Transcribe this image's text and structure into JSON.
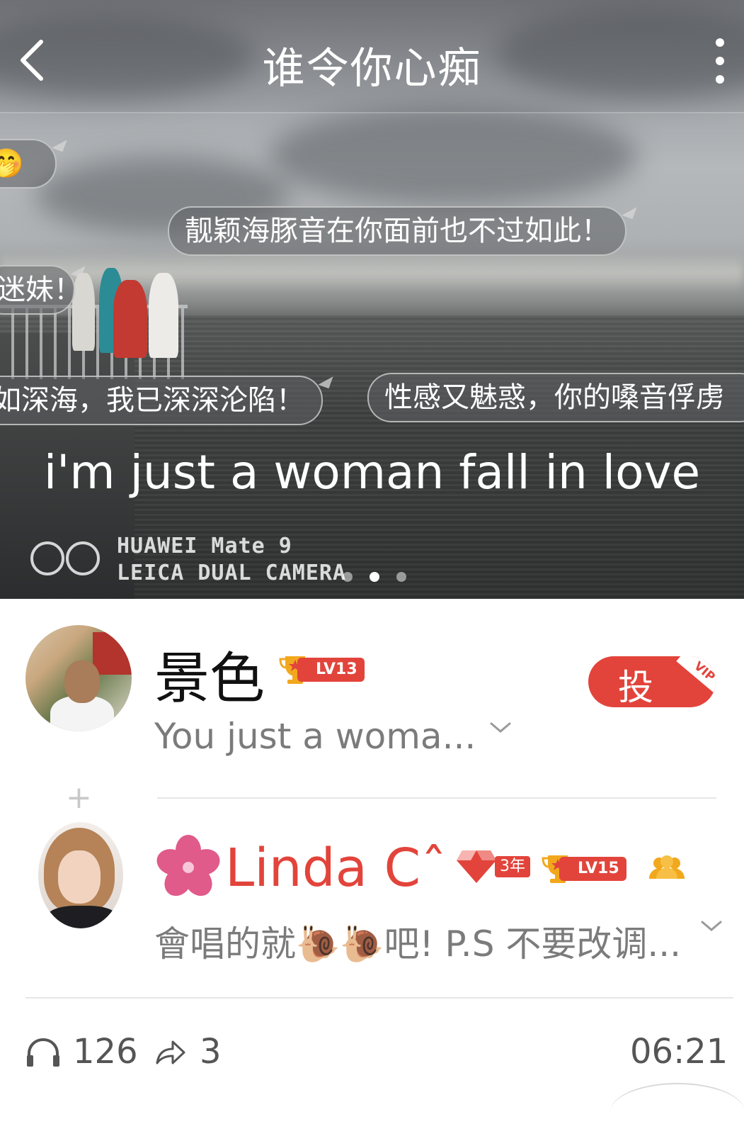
{
  "header": {
    "title": "谁令你心痴"
  },
  "hero": {
    "danmaku": [
      "🤭",
      "靓颖海豚音在你面前也不过如此！",
      "迷妹！",
      "如深海，我已深深沦陷！",
      "性感又魅惑，你的嗓音俘虏"
    ],
    "lyric": "i'm just a woman fall in love",
    "camera_line1": "HUAWEI Mate 9",
    "camera_line2": "LEICA DUAL CAMERA",
    "pager": {
      "count": 3,
      "active_index": 1
    }
  },
  "comments": [
    {
      "name": "景色",
      "level": "LV13",
      "snippet": "You just a woma...",
      "action_label": "投",
      "vip_label": "VIP"
    },
    {
      "name": "Linda Cˆ",
      "year_badge": "3年",
      "level": "LV15",
      "snippet": "會唱的就🐌🐌吧! P.S 不要改调..."
    }
  ],
  "footer": {
    "listens": "126",
    "shares": "3",
    "duration": "06:21"
  },
  "colors": {
    "accent": "#e2443b",
    "gold": "#f2a81d",
    "muted_text": "#7b7b7b"
  },
  "icons": [
    "back-arrow-icon",
    "more-vertical-icon",
    "trophy-icon",
    "chevron-down-icon",
    "plus-icon",
    "flower-icon",
    "diamond-year-icon",
    "fans-group-icon",
    "headphones-icon",
    "share-arrow-icon"
  ]
}
